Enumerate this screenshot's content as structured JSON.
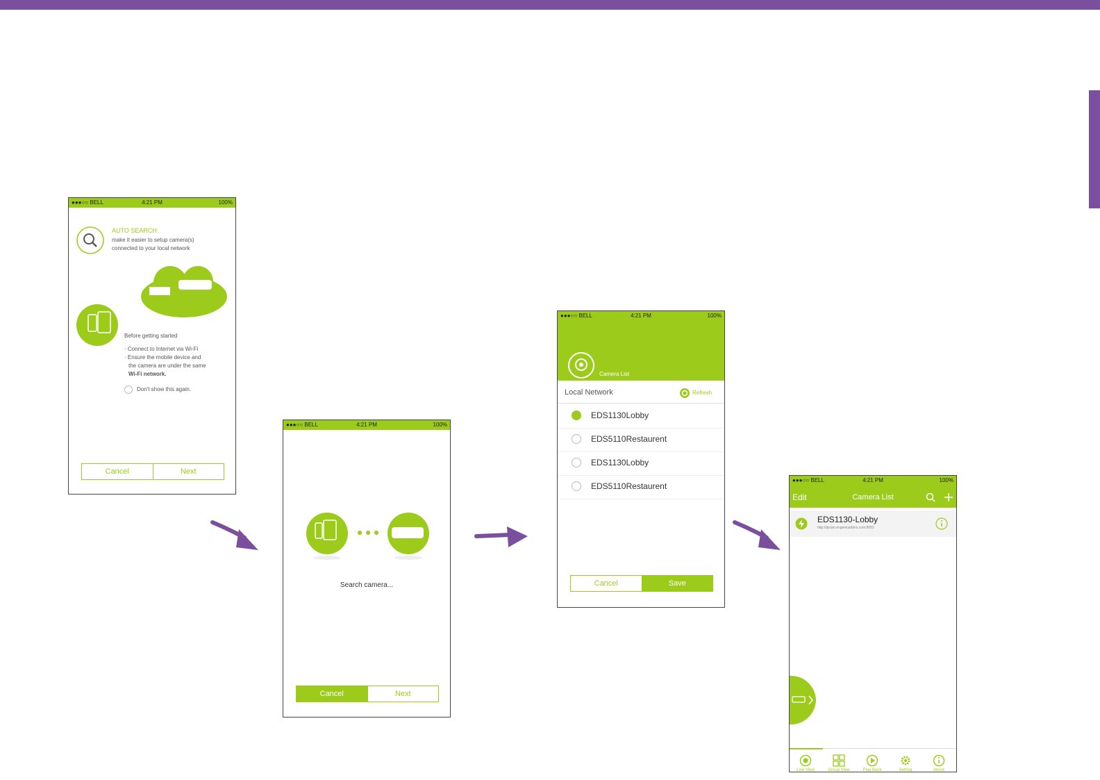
{
  "colors": {
    "accent": "#9ccb1c",
    "brand": "#7a4f9e"
  },
  "status_bar": {
    "carrier": "●●●○○ BELL",
    "time": "4:21 PM",
    "battery": "100%"
  },
  "screen1": {
    "heading": "AUTO SEARCH",
    "desc1": "make it easier to setup camera(s)",
    "desc2": "connected to your local network",
    "before": "Before getting started",
    "bullet1": "· Connect to Internet via Wi-Fi",
    "bullet2a": "· Ensure the mobile device and",
    "bullet2b": "the camera are under the same",
    "bullet2c": "Wi-Fi network.",
    "dont_show": "Don't show this again.",
    "cancel": "Cancel",
    "next": "Next"
  },
  "screen2": {
    "searching": "Search camera...",
    "cancel": "Cancel",
    "next": "Next"
  },
  "screen3": {
    "header_label": "Camera List",
    "section": "Local Network",
    "refresh": "Refresh",
    "cameras": [
      {
        "name": "EDS1130Lobby",
        "checked": true
      },
      {
        "name": "EDS5110Restaurent",
        "checked": false
      },
      {
        "name": "EDS1130Lobby",
        "checked": false
      },
      {
        "name": "EDS5110Restaurent",
        "checked": false
      }
    ],
    "cancel": "Cancel",
    "save": "Save"
  },
  "screen4": {
    "edit": "Edit",
    "title": "Camera List",
    "camera_name": "EDS1130-Lobby",
    "camera_url": "http://ipcam.engeniusddns.com:8092",
    "tabs": [
      "Live View",
      "Group View",
      "Play Back",
      "Setting",
      "About"
    ]
  }
}
